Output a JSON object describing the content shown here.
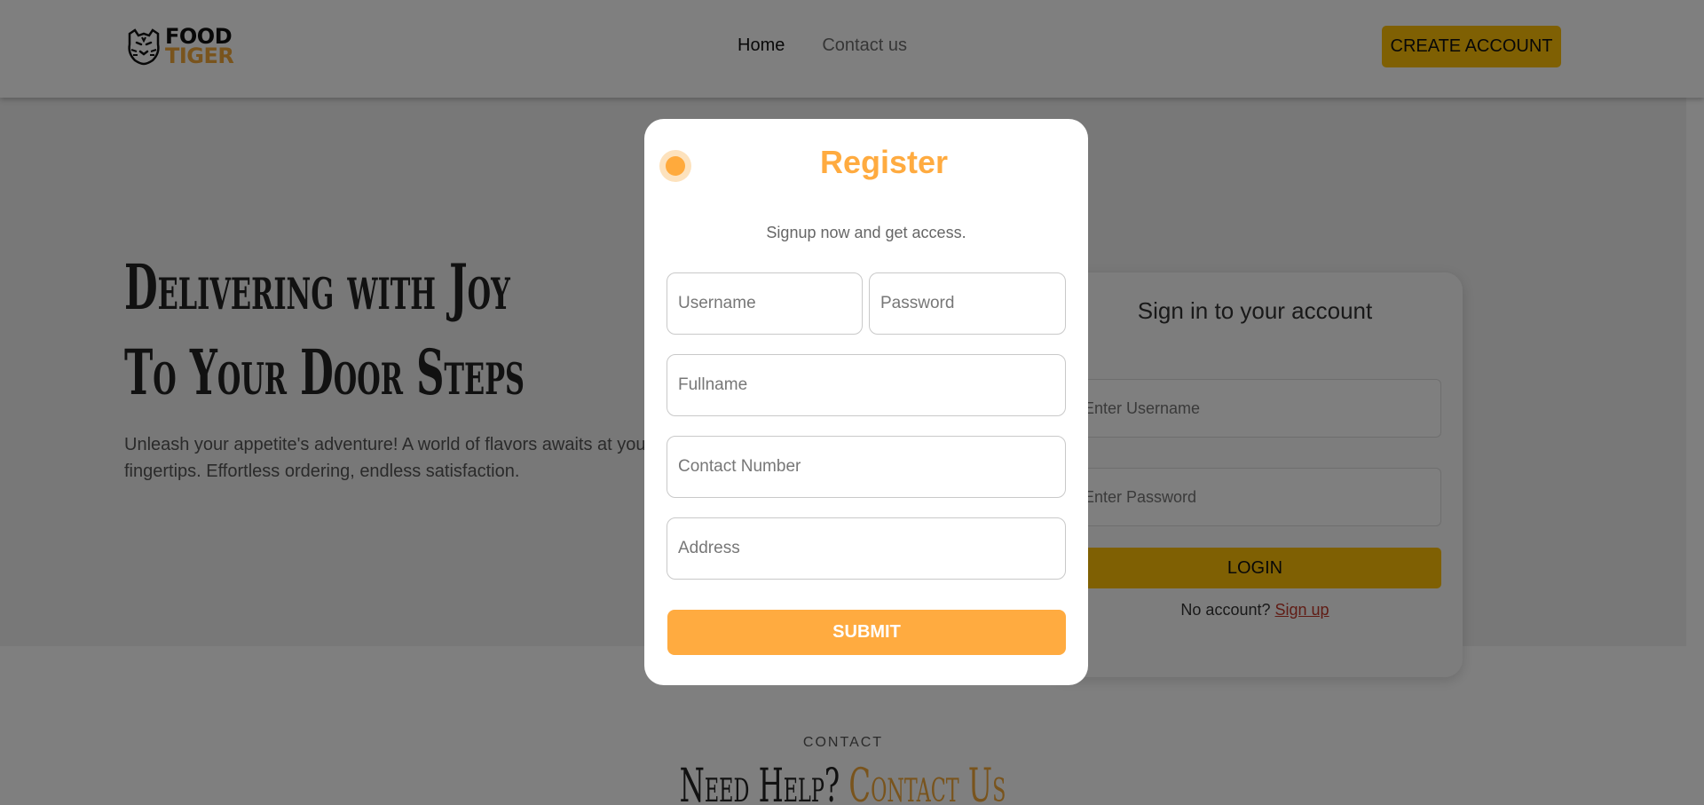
{
  "navbar": {
    "logo_line1": "FOOD",
    "logo_line2": "TIGER",
    "logo_icon": "tiger-head-icon",
    "links": [
      {
        "label": "Home",
        "active": true
      },
      {
        "label": "Contact us",
        "active": false
      }
    ],
    "create_account_label": "CREATE ACCOUNT"
  },
  "hero": {
    "title_line1": "Delivering with Joy",
    "title_line2": "To Your Door Steps",
    "description": "Unleash your appetite's adventure! A world of flavors awaits at your fingertips. Effortless ordering, endless satisfaction."
  },
  "login": {
    "title": "Sign in to your account",
    "username_placeholder": "Enter Username",
    "password_placeholder": "Enter Password",
    "login_label": "LOGIN",
    "no_account_text": "No account?",
    "signup_link": "Sign up"
  },
  "contact": {
    "eyebrow": "CONTACT",
    "title_part1": "Need Help?",
    "title_part2": "Contact Us"
  },
  "modal": {
    "title": "Register",
    "subtitle": "Signup now and get access.",
    "fields": {
      "username_placeholder": "Username",
      "password_placeholder": "Password",
      "fullname_placeholder": "Fullname",
      "contact_placeholder": "Contact Number",
      "address_placeholder": "Address"
    },
    "submit_label": "SUBMIT"
  },
  "colors": {
    "accent": "#ffab40",
    "brand_yellow": "#ffc107",
    "logo_orange": "#f2a93b",
    "link_red": "#c0392b"
  }
}
